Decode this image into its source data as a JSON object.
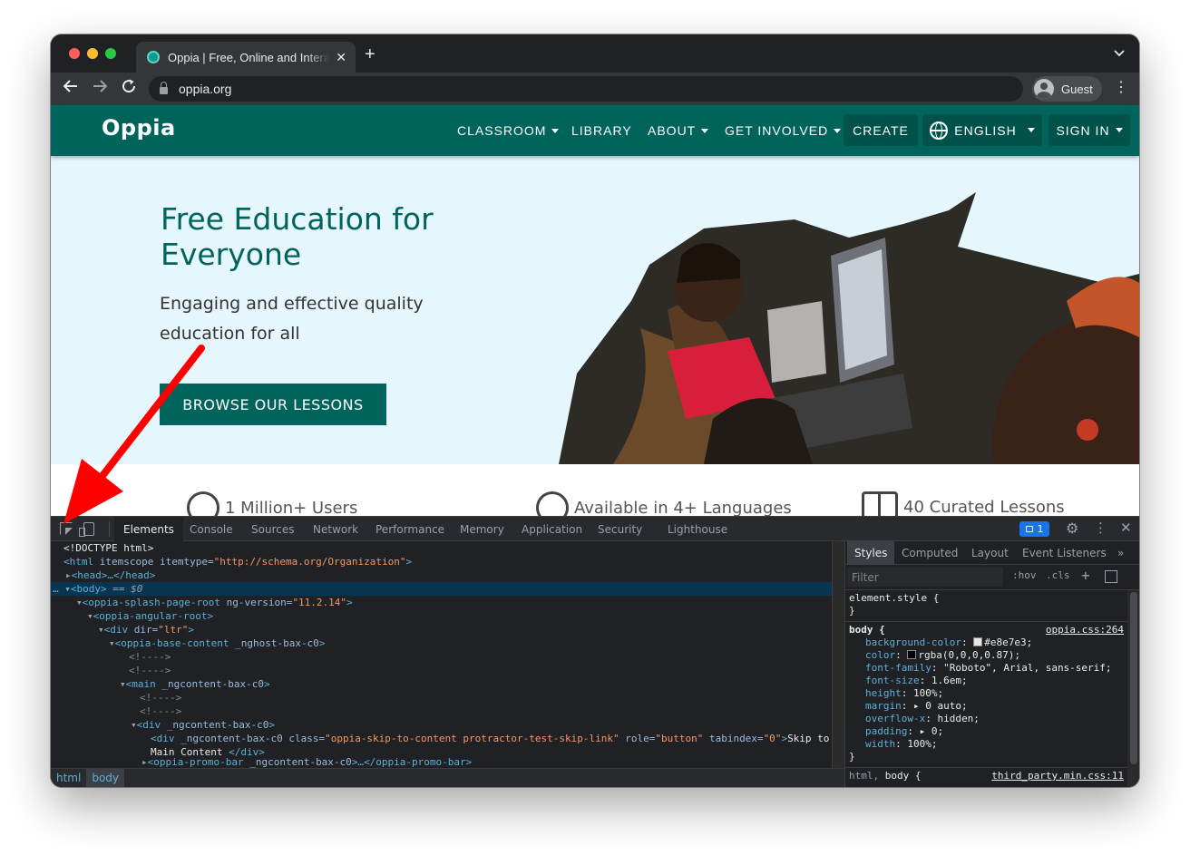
{
  "browser": {
    "tab_title": "Oppia | Free, Online and Interactive Lessons for Anyone",
    "tab_close": "✕",
    "new_tab": "+",
    "url": "oppia.org",
    "profile_label": "Guest"
  },
  "site": {
    "logo": "Oppia",
    "nav": {
      "classroom": "CLASSROOM",
      "library": "LIBRARY",
      "about": "ABOUT",
      "get_involved": "GET INVOLVED",
      "create": "CREATE",
      "language": "ENGLISH",
      "sign_in": "SIGN IN"
    },
    "hero": {
      "title": "Free Education for Everyone",
      "subtitle": "Engaging and effective quality education for all",
      "cta": "BROWSE OUR LESSONS"
    },
    "stats": {
      "users": "1 Million+ Users",
      "languages": "Available in 4+ Languages",
      "lessons": "40 Curated Lessons"
    }
  },
  "devtools": {
    "tabs": [
      "Elements",
      "Console",
      "Sources",
      "Network",
      "Performance",
      "Memory",
      "Application",
      "Security",
      "Lighthouse"
    ],
    "issues_count": "1",
    "styles_tabs": [
      "Styles",
      "Computed",
      "Layout",
      "Event Listeners"
    ],
    "filter_placeholder": "Filter",
    "hov": ":hov",
    "cls": ".cls",
    "breadcrumbs": [
      "html",
      "body"
    ],
    "dom": {
      "doctype": "<!DOCTYPE html>",
      "html_open": "<html",
      "itemscope": " itemscope itemtype=",
      "schema": "\"http://schema.org/Organization\"",
      "head": "<head>…</head>",
      "body": "<body>",
      "body_ref": " == $0",
      "splash": "<oppia-splash-page-root",
      "ngver_attr": " ng-version=",
      "ngver_val": "\"11.2.14\"",
      "angular_root": "<oppia-angular-root>",
      "div_dir": "<div",
      "dir_attr": " dir=",
      "dir_val": "\"ltr\"",
      "base_content": "<oppia-base-content",
      "nghost": " _nghost-bax-c0",
      "comment": "<!---->",
      "main": "<main",
      "ngcontent": " _ngcontent-bax-c0",
      "div": "<div",
      "skip_class_attr": " class=",
      "skip_class_val": "\"oppia-skip-to-content protractor-test-skip-link\"",
      "role_attr": " role=",
      "role_val": "\"button\"",
      "tabindex_attr": " tabindex=",
      "tabindex_val": "\"0\"",
      "skip_text_1": "Skip to",
      "skip_text_2": "Main Content ",
      "div_close": "</div>",
      "promo": "<oppia-promo-bar",
      "promo_close": "</oppia-promo-bar>"
    },
    "styles": {
      "element_style": "element.style {",
      "body_selector": "body {",
      "body_source": "oppia.css:264",
      "decls": [
        {
          "prop": "background-color",
          "value": "#e8e7e3;",
          "swatch": "#e8e7e3"
        },
        {
          "prop": "color",
          "value": "rgba(0,0,0,0.87);",
          "swatch": "rgba(0,0,0,0.87)"
        },
        {
          "prop": "font-family",
          "value": "\"Roboto\", Arial, sans-serif;"
        },
        {
          "prop": "font-size",
          "value": "1.6em;"
        },
        {
          "prop": "height",
          "value": "100%;"
        },
        {
          "prop": "margin",
          "value": "▸ 0 auto;"
        },
        {
          "prop": "overflow-x",
          "value": "hidden;"
        },
        {
          "prop": "padding",
          "value": "▸ 0;"
        },
        {
          "prop": "width",
          "value": "100%;"
        }
      ],
      "next_selector": "html, body {",
      "next_source": "third_party.min.css:11"
    }
  }
}
